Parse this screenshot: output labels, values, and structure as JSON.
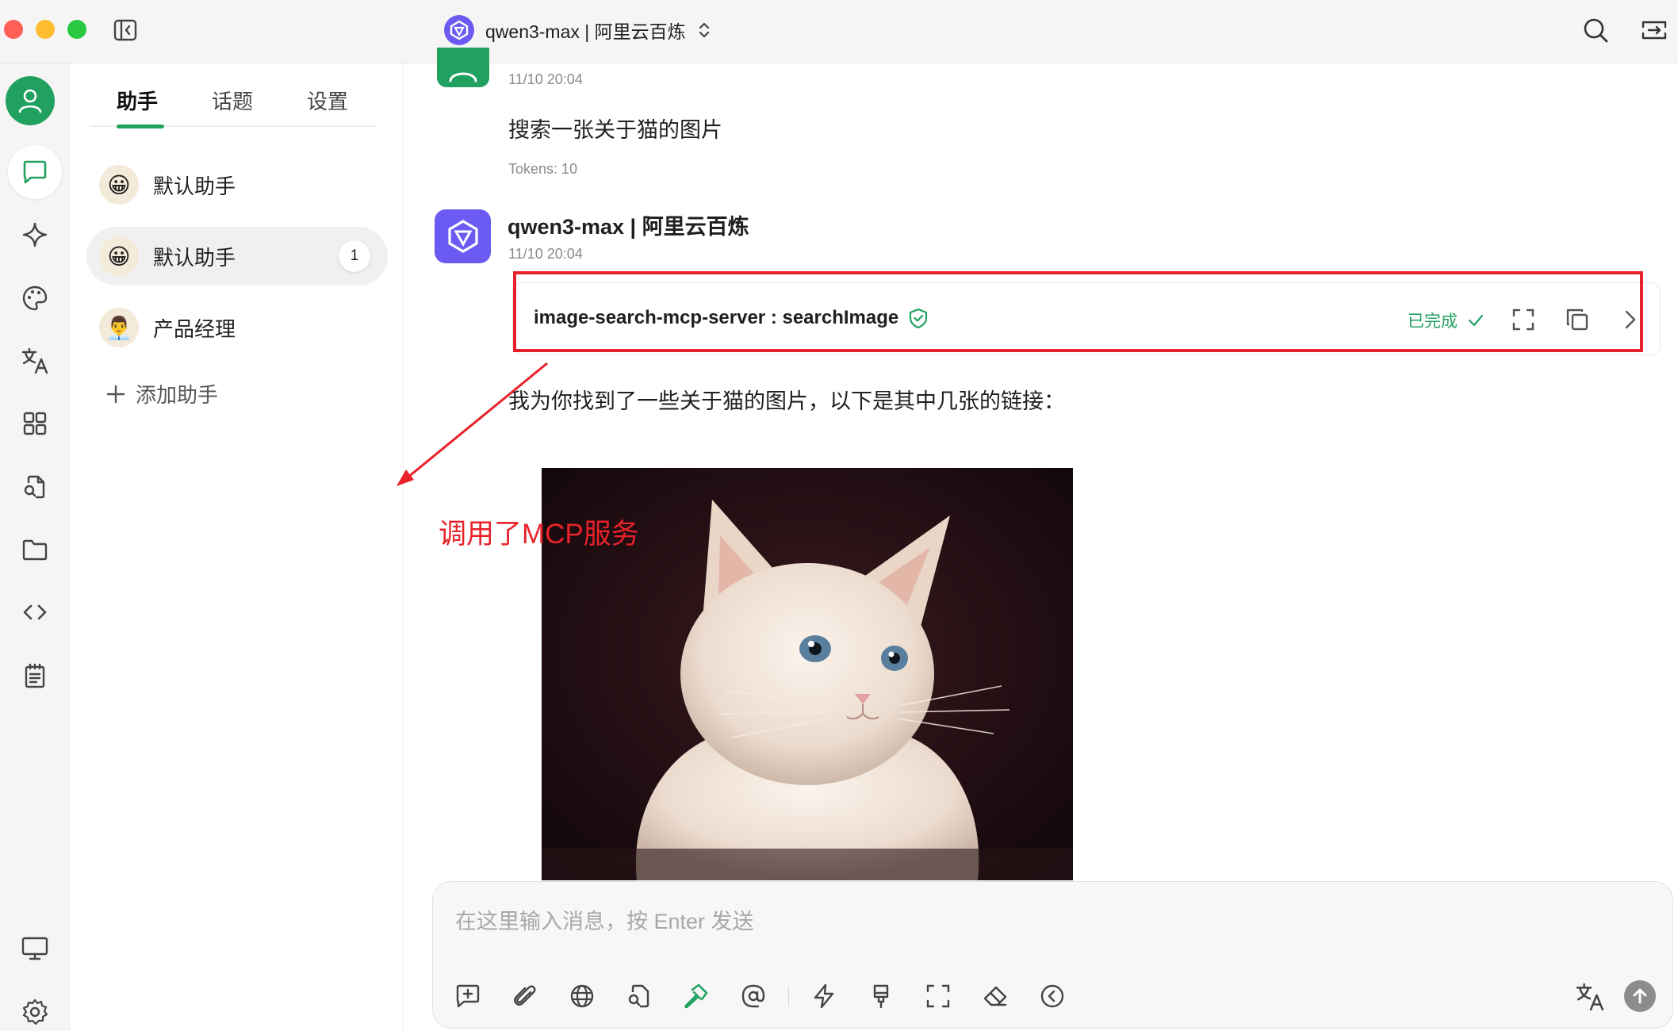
{
  "titlebar": {
    "model_label": "qwen3-max | 阿里云百炼"
  },
  "panel": {
    "tabs": [
      {
        "label": "助手"
      },
      {
        "label": "话题"
      },
      {
        "label": "设置"
      }
    ],
    "assistants": [
      {
        "emoji": "😀",
        "label": "默认助手"
      },
      {
        "emoji": "😀",
        "label": "默认助手",
        "badge": "1"
      },
      {
        "emoji": "👨‍💼",
        "label": "产品经理"
      }
    ],
    "add_label": "添加助手"
  },
  "chat": {
    "user_message": {
      "time": "11/10 20:04",
      "text": "搜索一张关于猫的图片",
      "tokens": "Tokens: 10"
    },
    "model_message": {
      "name": "qwen3-max | 阿里云百炼",
      "time": "11/10 20:04",
      "tool_call": {
        "name": "image-search-mcp-server : searchImage",
        "status": "已完成"
      },
      "text": "我为你找到了一些关于猫的图片，以下是其中几张的链接："
    },
    "annotation": "调用了MCP服务"
  },
  "input": {
    "placeholder": "在这里输入消息，按 Enter 发送"
  },
  "colors": {
    "accent": "#21a160",
    "model_logo": "#6b5bf2",
    "annotation": "#e8222a"
  },
  "icons": {
    "rail": [
      "user-avatar-icon",
      "chat-icon",
      "sparkle-icon",
      "palette-icon",
      "translate-icon",
      "apps-icon",
      "file-search-icon",
      "folder-icon",
      "code-icon",
      "notes-icon",
      "monitor-icon",
      "settings-icon"
    ],
    "input_toolbar": [
      "new-topic-icon",
      "attachment-icon",
      "web-search-icon",
      "file-icon",
      "mcp-tools-icon",
      "mention-icon",
      "quick-phrase-icon",
      "clear-style-icon",
      "expand-icon",
      "eraser-icon",
      "collapse-icon",
      "translate-icon",
      "send-icon"
    ]
  }
}
